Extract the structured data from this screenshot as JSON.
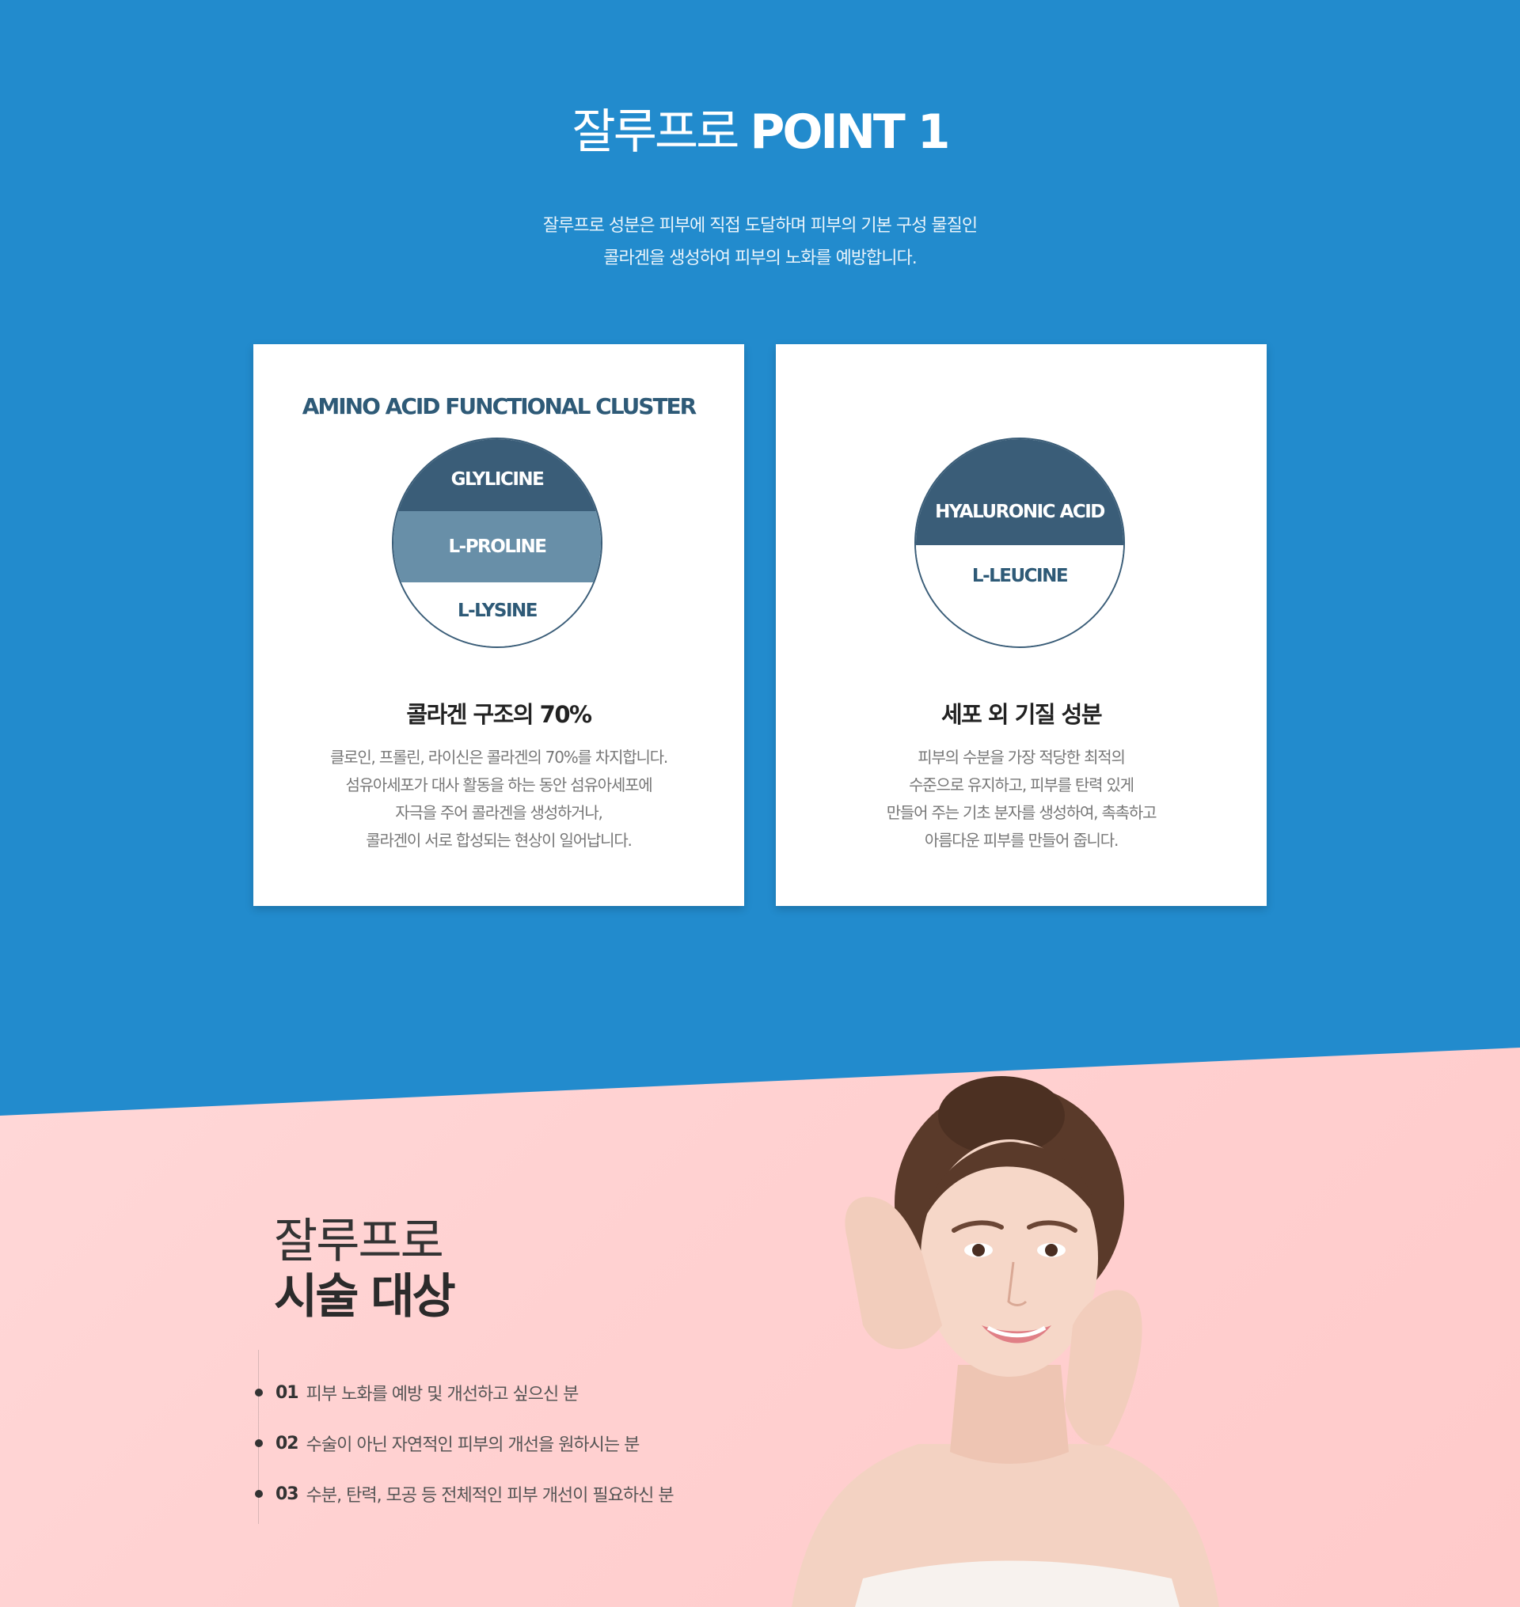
{
  "header": {
    "title_light": "잘루프로 ",
    "title_bold": "POINT 1",
    "lead_lines": [
      "잘루프로 성분은 피부에 직접 도달하며 피부의 기본 구성 물질인",
      "콜라겐을 생성하여 피부의 노화를  예방합니다."
    ]
  },
  "cards": [
    {
      "top_label": "AMINO ACID FUNCTIONAL CLUSTER",
      "bands": [
        "GLYLICINE",
        "L-PROLINE",
        "L-LYSINE"
      ],
      "heading": "콜라겐 구조의 70%",
      "body": [
        "클로인, 프롤린, 라이신은 콜라겐의 70%를 차지합니다.",
        "섬유아세포가 대사 활동을 하는 동안 섬유아세포에",
        "자극을 주어 콜라겐을 생성하거나,",
        "콜라겐이 서로 합성되는 현상이 일어납니다."
      ]
    },
    {
      "top_label": "",
      "bands": [
        "HYALURONIC ACID",
        "L-LEUCINE"
      ],
      "heading": "세포 외 기질 성분",
      "body": [
        "피부의 수분을 가장 적당한 최적의",
        "수준으로 유지하고, 피부를 탄력 있게",
        "만들어 주는 기초 분자를 생성하여, 촉촉하고",
        "아름다운 피부를 만들어 줍니다."
      ]
    }
  ],
  "target": {
    "title_light": "잘루프로",
    "title_bold": "시술 대상",
    "items": [
      {
        "num": "01",
        "text": "피부 노화를 예방 및 개선하고 싶으신 분"
      },
      {
        "num": "02",
        "text": "수술이 아닌 자연적인 피부의 개선을 원하시는 분"
      },
      {
        "num": "03",
        "text": "수분, 탄력, 모공 등 전체적인 피부 개선이 필요하신 분"
      }
    ]
  },
  "colors": {
    "blue": "#228bcd",
    "navy": "#3a5d78",
    "steel": "#688fa8",
    "pink": "#ffd6d6"
  },
  "image": {
    "subject": "smiling-woman-portrait"
  }
}
